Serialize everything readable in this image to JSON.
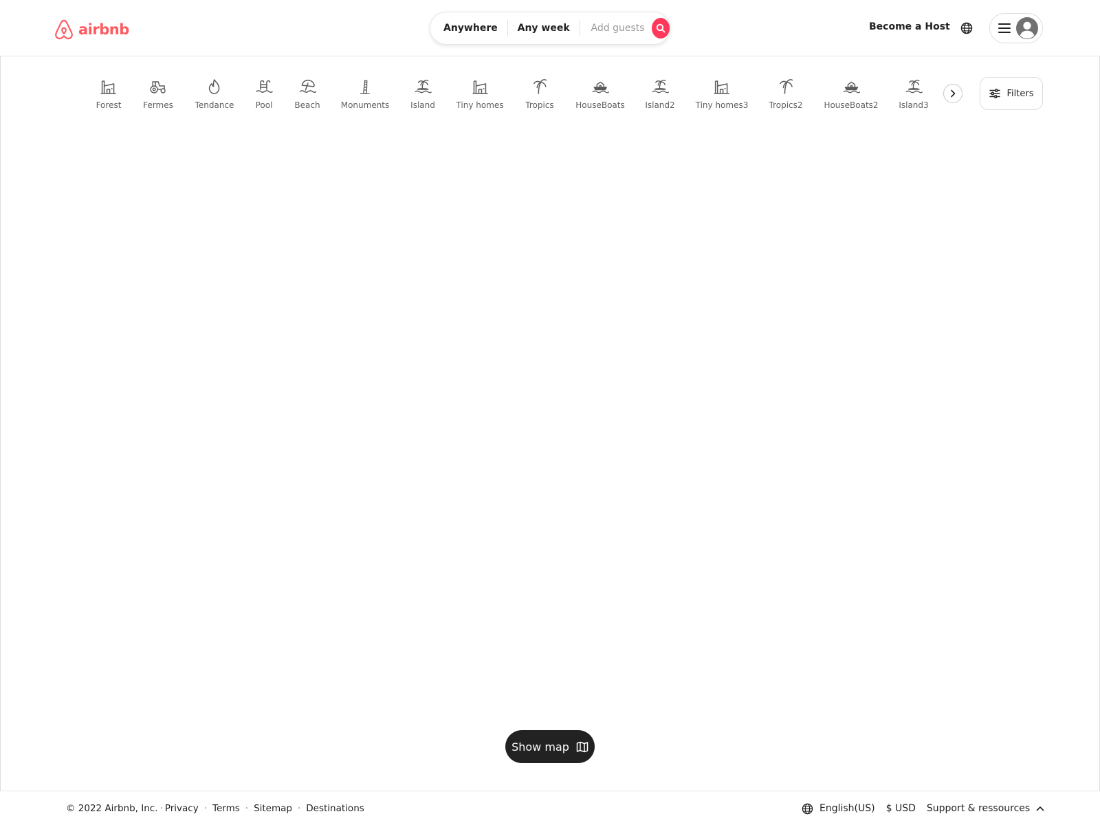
{
  "brand": {
    "name": "airbnb",
    "color": "#ff5a5f"
  },
  "search": {
    "anywhere": "Anywhere",
    "any_week": "Any week",
    "add_guests": "Add guests",
    "button_color": "#ff385c",
    "search_icon": "magnifier-icon"
  },
  "header": {
    "become_host": "Become a Host",
    "globe_icon": "globe-icon",
    "menu_icon": "hamburger-icon",
    "avatar_icon": "user-avatar-icon"
  },
  "categories": [
    {
      "label": "Forest",
      "icon": "building-icon"
    },
    {
      "label": "Fermes",
      "icon": "tractor-icon"
    },
    {
      "label": "Tendance",
      "icon": "flame-icon"
    },
    {
      "label": "Pool",
      "icon": "pool-icon"
    },
    {
      "label": "Beach",
      "icon": "beach-umbrella-icon"
    },
    {
      "label": "Monuments",
      "icon": "leaning-tower-icon"
    },
    {
      "label": "Island",
      "icon": "island-icon"
    },
    {
      "label": "Tiny homes",
      "icon": "building-icon"
    },
    {
      "label": "Tropics",
      "icon": "palm-tree-icon"
    },
    {
      "label": "HouseBoats",
      "icon": "houseboat-icon"
    },
    {
      "label": "Island2",
      "icon": "island-icon"
    },
    {
      "label": "Tiny homes3",
      "icon": "building-icon"
    },
    {
      "label": "Tropics2",
      "icon": "palm-tree-icon"
    },
    {
      "label": "HouseBoats2",
      "icon": "houseboat-icon"
    },
    {
      "label": "Island3",
      "icon": "island-icon"
    }
  ],
  "category_nav": {
    "next_icon": "chevron-right-icon"
  },
  "filters": {
    "label": "Filters",
    "icon": "sliders-icon"
  },
  "show_map": {
    "label": "Show map",
    "icon": "map-icon",
    "background": "#222222"
  },
  "footer": {
    "copyright": "© 2022 Airbnb, Inc.",
    "links": [
      "Privacy",
      "Terms",
      "Sitemap",
      "Destinations"
    ],
    "language": "English(US)",
    "currency": "$ USD",
    "support": "Support & ressources",
    "support_icon": "chevron-up-icon"
  }
}
